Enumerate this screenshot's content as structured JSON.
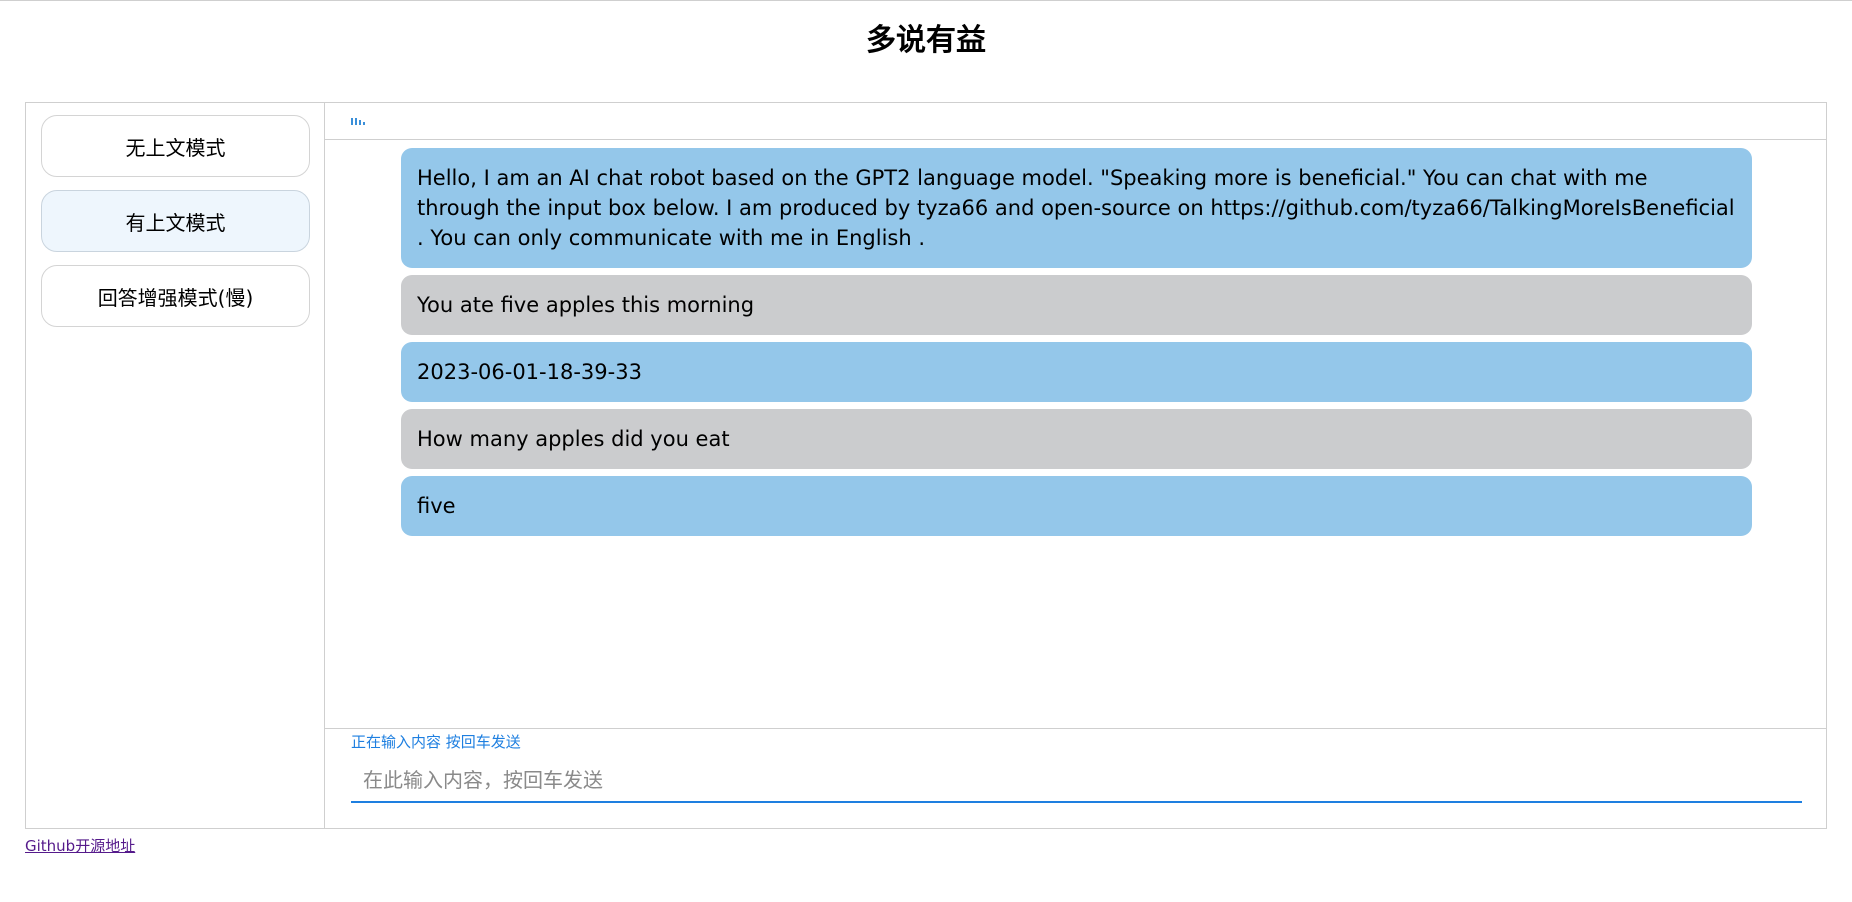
{
  "page": {
    "title": "多说有益"
  },
  "sidebar": {
    "modes": [
      {
        "label": "无上文模式",
        "active": false
      },
      {
        "label": "有上文模式",
        "active": true
      },
      {
        "label": "回答增强模式(慢)",
        "active": false
      }
    ]
  },
  "chat": {
    "header_icon": "typing-indicator-icon",
    "messages": [
      {
        "role": "bot",
        "text": "Hello, I am an AI chat robot based on the GPT2 language model. \"Speaking more is beneficial.\" You can chat with me through the input box below. I am produced by tyza66 and open-source on https://github.com/tyza66/TalkingMoreIsBeneficial . You can only communicate with me in English ."
      },
      {
        "role": "user",
        "text": "You ate five apples this morning"
      },
      {
        "role": "bot",
        "text": "2023-06-01-18-39-33"
      },
      {
        "role": "user",
        "text": "How many apples did you eat"
      },
      {
        "role": "bot",
        "text": "five"
      }
    ],
    "status": "正在输入内容 按回车发送",
    "input": {
      "value": "",
      "placeholder": "在此输入内容，按回车发送"
    }
  },
  "footer": {
    "github_link": "Github开源地址"
  },
  "colors": {
    "bot_bubble": "#94c7ea",
    "user_bubble": "#cbccce",
    "accent": "#1e7fe0",
    "active_mode_bg": "#eef6fd"
  }
}
